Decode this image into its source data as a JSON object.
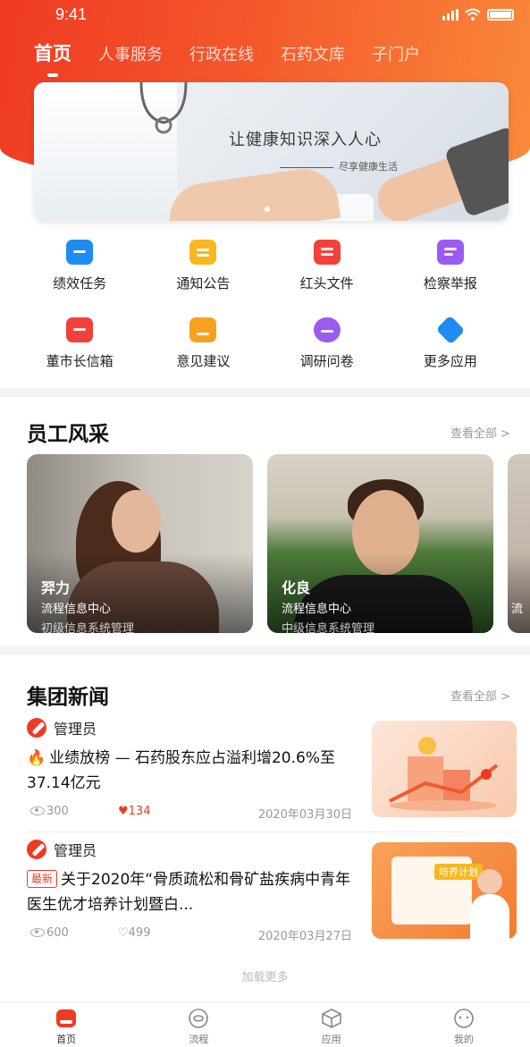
{
  "status_bar": {
    "time": "9:41"
  },
  "header": {
    "tabs": [
      {
        "label": "首页",
        "active": true
      },
      {
        "label": "人事服务",
        "active": false
      },
      {
        "label": "行政在线",
        "active": false
      },
      {
        "label": "石药文库",
        "active": false
      },
      {
        "label": "子门户",
        "active": false
      }
    ],
    "banner": {
      "title": "让健康知识深入人心",
      "subtitle": "尽享健康生活"
    }
  },
  "apps": [
    {
      "label": "绩效任务",
      "icon": "performance-task-icon",
      "color": "#1e8cf0"
    },
    {
      "label": "通知公告",
      "icon": "notice-icon",
      "color": "#f7b81f"
    },
    {
      "label": "红头文件",
      "icon": "red-document-icon",
      "color": "#f2413a"
    },
    {
      "label": "检察举报",
      "icon": "report-icon",
      "color": "#9a5cf0"
    },
    {
      "label": "董市长信箱",
      "icon": "mailbox-icon",
      "color": "#f2413a"
    },
    {
      "label": "意见建议",
      "icon": "suggestion-icon",
      "color": "#f7a21f"
    },
    {
      "label": "调研问卷",
      "icon": "survey-icon",
      "color": "#9a5cf0"
    },
    {
      "label": "更多应用",
      "icon": "more-apps-icon",
      "color": "#1e8cf0"
    }
  ],
  "staff": {
    "title": "员工风采",
    "see_all": "查看全部 >",
    "cards": [
      {
        "name": "羿力",
        "dept": "流程信息中心",
        "role": "初级信息系统管理"
      },
      {
        "name": "化良",
        "dept": "流程信息中心",
        "role": "中级信息系统管理"
      },
      {
        "name": "",
        "dept": "流",
        "role": ""
      }
    ]
  },
  "news": {
    "title": "集团新闻",
    "see_all": "查看全部 >",
    "items": [
      {
        "author": "管理员",
        "badge": "",
        "title": "业绩放榜 — 石药股东应占溢利增20.6%至37.14亿元",
        "views": "300",
        "likes": "134",
        "liked": true,
        "date": "2020年03月30日"
      },
      {
        "author": "管理员",
        "badge": "最新",
        "title": "关于2020年“骨质疏松和骨矿盐疾病中青年医生优才培养计划暨白...",
        "views": "600",
        "likes": "499",
        "liked": false,
        "date": "2020年03月27日",
        "thumb_text": "培养计划"
      }
    ],
    "load_more": "加载更多"
  },
  "bottom_nav": [
    {
      "label": "首页",
      "icon": "home-icon",
      "active": true
    },
    {
      "label": "流程",
      "icon": "process-icon",
      "active": false
    },
    {
      "label": "应用",
      "icon": "apps-icon",
      "active": false
    },
    {
      "label": "我的",
      "icon": "profile-icon",
      "active": false
    }
  ],
  "colors": {
    "brand": "#ef3a23",
    "brand_light": "#f98a3a"
  }
}
